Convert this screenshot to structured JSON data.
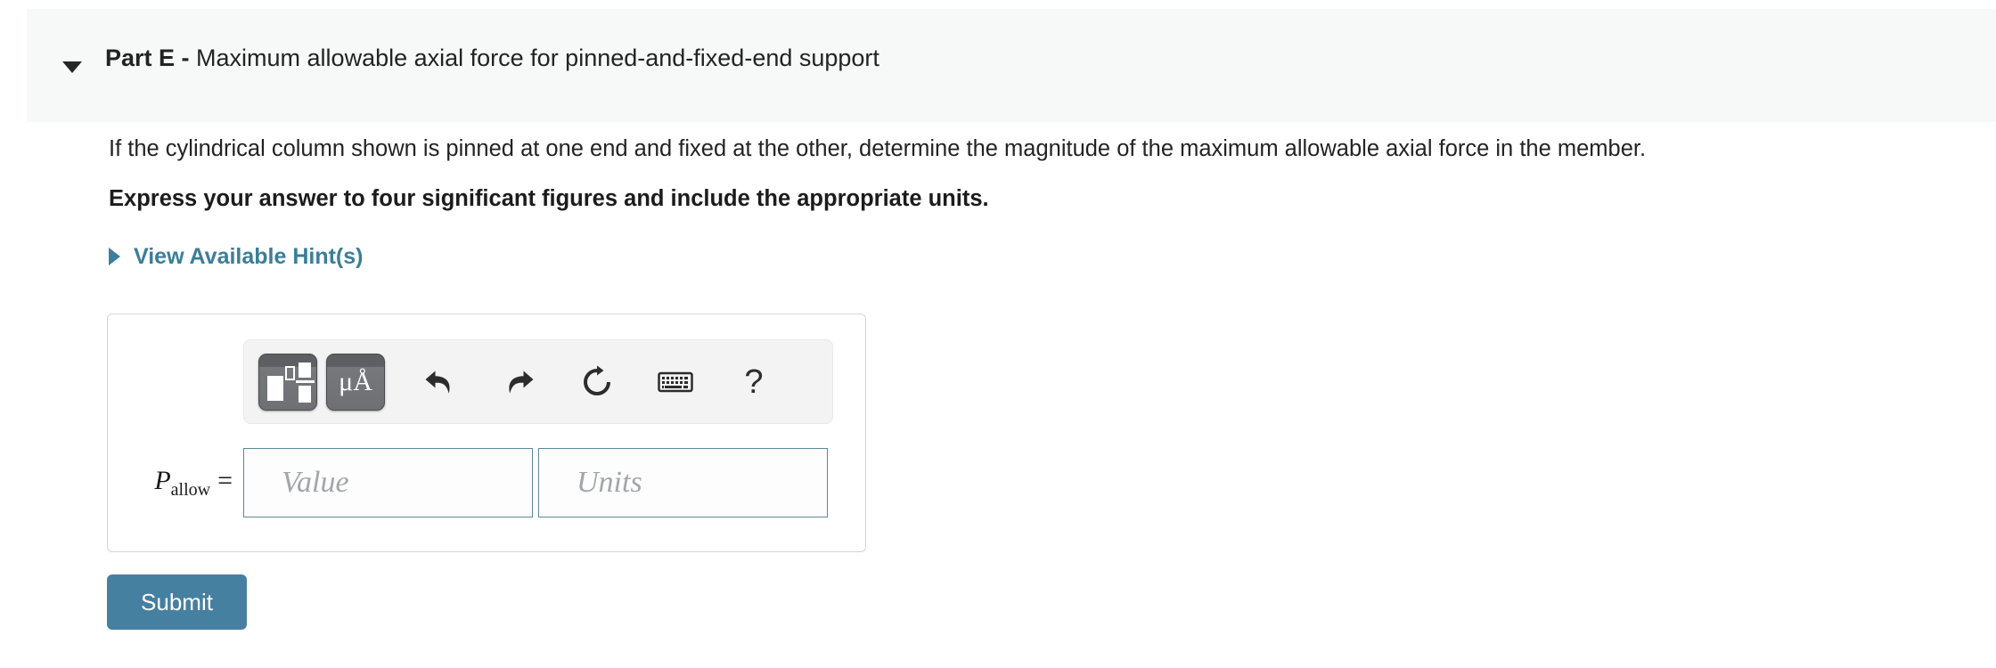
{
  "part_header": {
    "collapse_icon": "caret-down-icon",
    "label": "Part E -",
    "description": " Maximum allowable axial force for pinned-and-fixed-end support"
  },
  "problem": {
    "statement": "If the cylindrical column shown is pinned at one end and fixed at the other, determine the magnitude of the maximum allowable axial force in the member.",
    "instruction": "Express your answer to four significant figures and include the appropriate units."
  },
  "hints": {
    "expand_icon": "caret-right-icon",
    "label": "View Available Hint(s)",
    "color": "#3b7e98"
  },
  "answer_area": {
    "toolbar": {
      "template_button": {
        "icon": "math-template-icon",
        "label": ""
      },
      "units_button": {
        "icon": "units-icon",
        "label": "μÅ"
      },
      "undo_button": {
        "icon": "undo-arrow-icon"
      },
      "redo_button": {
        "icon": "redo-arrow-icon"
      },
      "reset_button": {
        "icon": "reset-circular-arrow-icon"
      },
      "keyboard_button": {
        "icon": "keyboard-icon"
      },
      "help_button": {
        "icon": "question-mark-icon",
        "label": "?"
      }
    },
    "variable": {
      "symbol": "P",
      "subscript": "allow",
      "equals": "="
    },
    "value_input": {
      "value": "",
      "placeholder": "Value"
    },
    "units_input": {
      "value": "",
      "placeholder": "Units"
    },
    "border_color": "#5b8799"
  },
  "submit": {
    "label": "Submit",
    "color": "#4680a0"
  }
}
